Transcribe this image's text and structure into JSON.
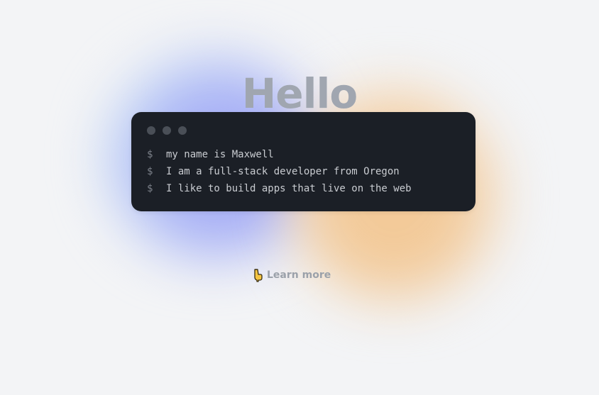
{
  "hero": {
    "heading": "Hello"
  },
  "terminal": {
    "prompt_symbol": "$",
    "lines": [
      "my name is Maxwell",
      "I am a full-stack developer from Oregon",
      "I like to build apps that live on the web"
    ]
  },
  "cta": {
    "label": "Learn more",
    "icon": "pointing-down-hand-icon"
  },
  "colors": {
    "background": "#f3f4f6",
    "terminal_bg": "#1b1f26",
    "heading": "#a0a6b0",
    "blob_blue": "#a3a8f7",
    "blob_orange": "#f3c894"
  }
}
